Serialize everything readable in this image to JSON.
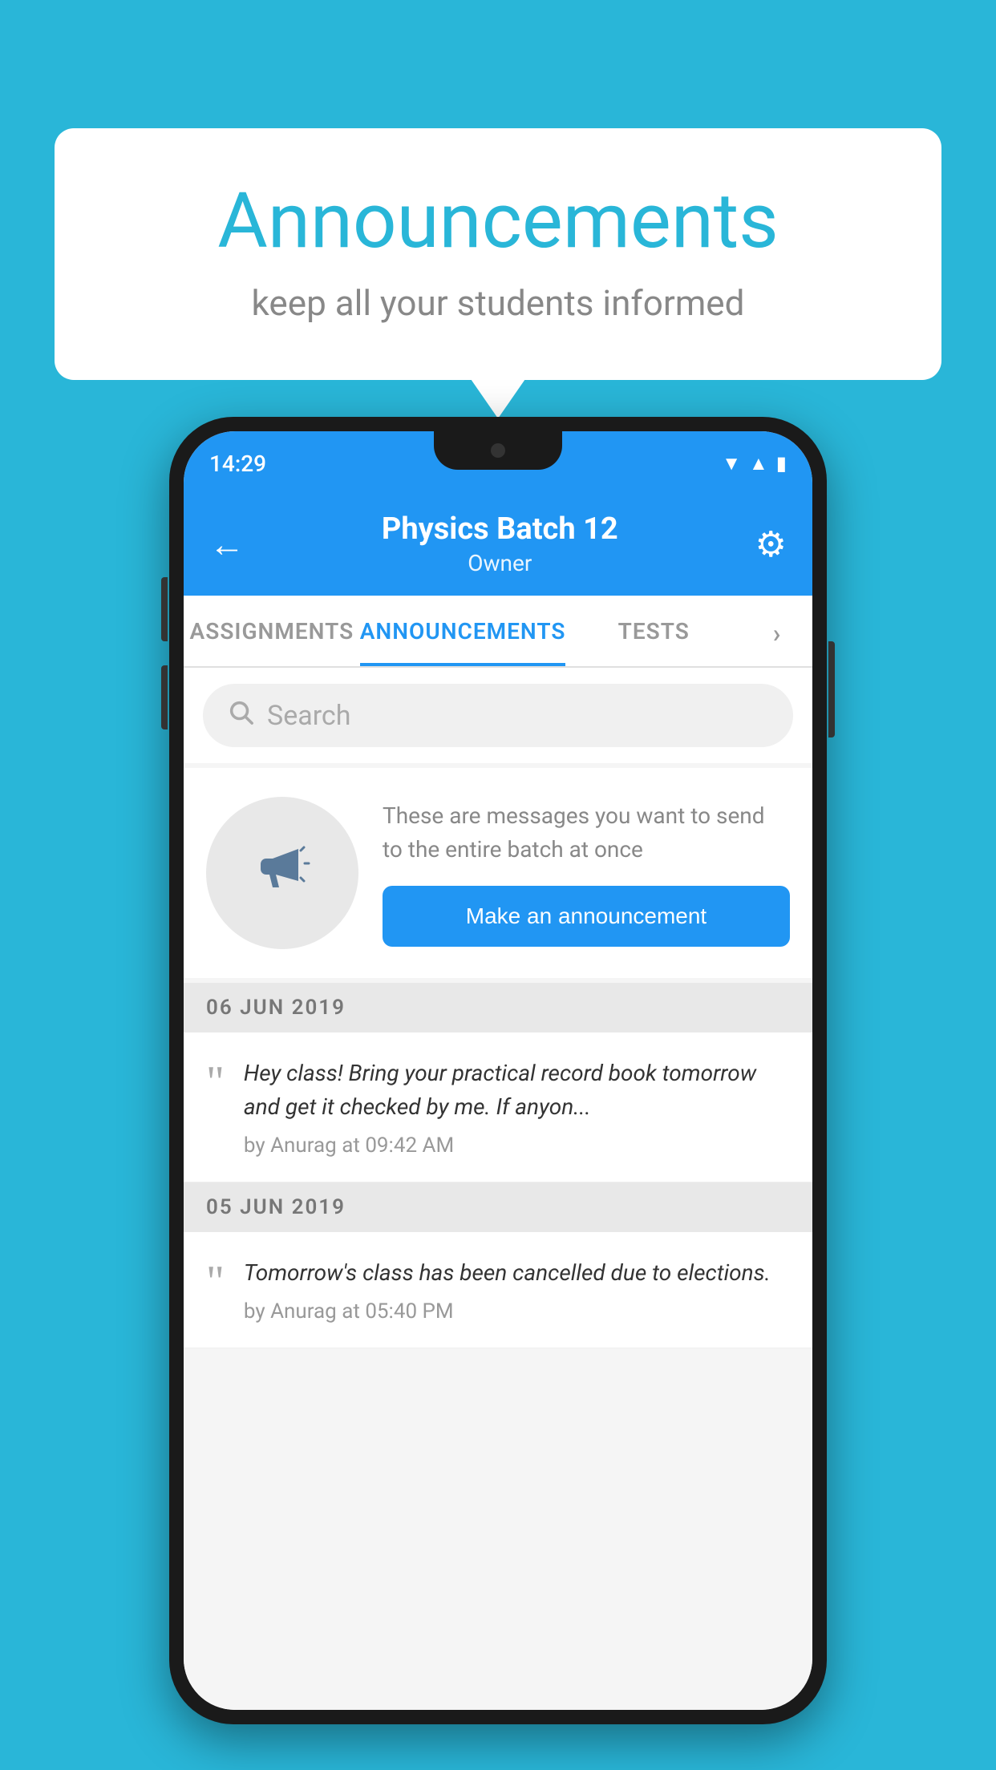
{
  "bubble": {
    "title": "Announcements",
    "subtitle": "keep all your students informed"
  },
  "phone": {
    "status_time": "14:29",
    "header": {
      "batch_name": "Physics Batch 12",
      "role": "Owner",
      "back_label": "←",
      "gear_label": "⚙"
    },
    "tabs": [
      {
        "label": "ASSIGNMENTS",
        "active": false
      },
      {
        "label": "ANNOUNCEMENTS",
        "active": true
      },
      {
        "label": "TESTS",
        "active": false
      },
      {
        "label": "›",
        "active": false
      }
    ],
    "search": {
      "placeholder": "Search"
    },
    "announcement_prompt": {
      "description": "These are messages you want to send to the entire batch at once",
      "button_label": "Make an announcement"
    },
    "announcements": [
      {
        "date": "06  JUN  2019",
        "text": "Hey class! Bring your practical record book tomorrow and get it checked by me. If anyon...",
        "meta": "by Anurag at 09:42 AM"
      },
      {
        "date": "05  JUN  2019",
        "text": "Tomorrow's class has been cancelled due to elections.",
        "meta": "by Anurag at 05:40 PM"
      }
    ]
  }
}
